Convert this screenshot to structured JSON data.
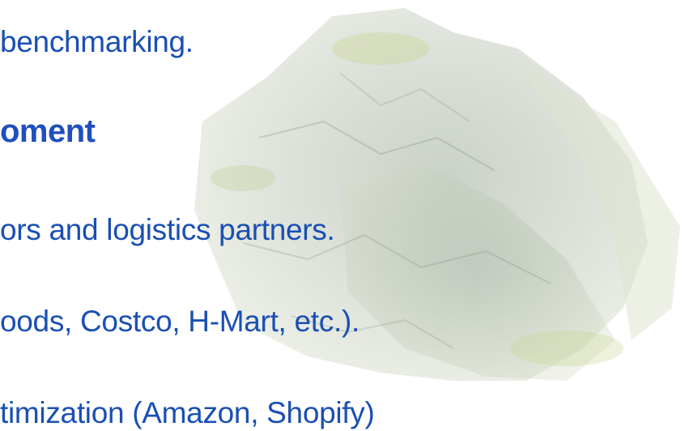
{
  "slide": {
    "lines": [
      "benchmarking.",
      "oment",
      "ors and logistics partners.",
      "oods, Costco, H-Mart, etc.).",
      "timization (Amazon, Shopify)"
    ]
  },
  "colors": {
    "text": "#1a4fb3",
    "heading": "#1f4fbf",
    "background": "#ffffff"
  },
  "image": {
    "name": "seaweed-sheet-photo"
  }
}
